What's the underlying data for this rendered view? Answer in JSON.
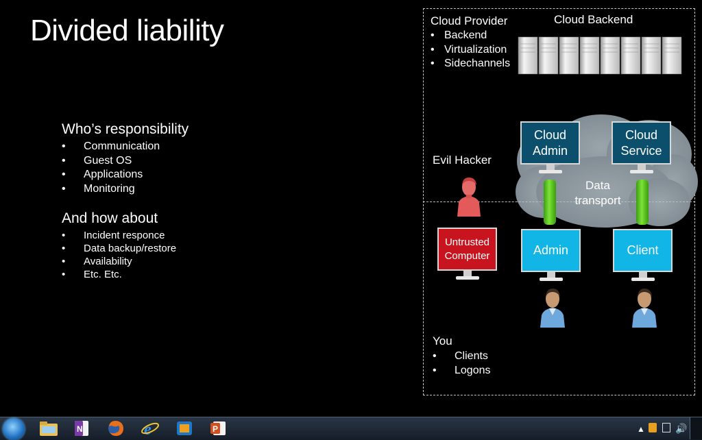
{
  "slide": {
    "title": "Divided liability",
    "responsibility": {
      "heading": "Who’s responsibility",
      "items": [
        "Communication",
        "Guest OS",
        "Applications",
        "Monitoring"
      ]
    },
    "how_about": {
      "heading": "And how about",
      "items": [
        "Incident responce",
        "Data backup/restore",
        "Availability",
        "Etc. Etc."
      ]
    }
  },
  "diagram": {
    "cloud_provider": {
      "heading": "Cloud Provider",
      "items": [
        "Backend",
        "Virtualization",
        "Sidechannels"
      ]
    },
    "cloud_backend_label": "Cloud Backend",
    "evil_hacker_label": "Evil Hacker",
    "data_transport_label": "Data transport",
    "monitors": {
      "cloud_admin": "Cloud Admin",
      "cloud_service": "Cloud Service",
      "untrusted_computer": "Untrusted Computer",
      "admin": "Admin",
      "client": "Client"
    },
    "you": {
      "heading": "You",
      "items": [
        "Clients",
        "Logons"
      ]
    }
  },
  "taskbar": {
    "icons": [
      "windows-start-icon",
      "file-explorer-icon",
      "onenote-icon",
      "firefox-icon",
      "internet-explorer-icon",
      "virtualbox-icon",
      "powerpoint-icon"
    ],
    "tray_icons": [
      "show-hidden-icons-arrow",
      "notification-icon",
      "network-icon",
      "volume-icon"
    ]
  },
  "colors": {
    "background": "#000000",
    "dark_monitor": "#0b4f6c",
    "light_monitor": "#12b6e6",
    "untrusted_monitor": "#c8141e",
    "pipe": "#6fd32d",
    "hacker": "#e05252"
  }
}
